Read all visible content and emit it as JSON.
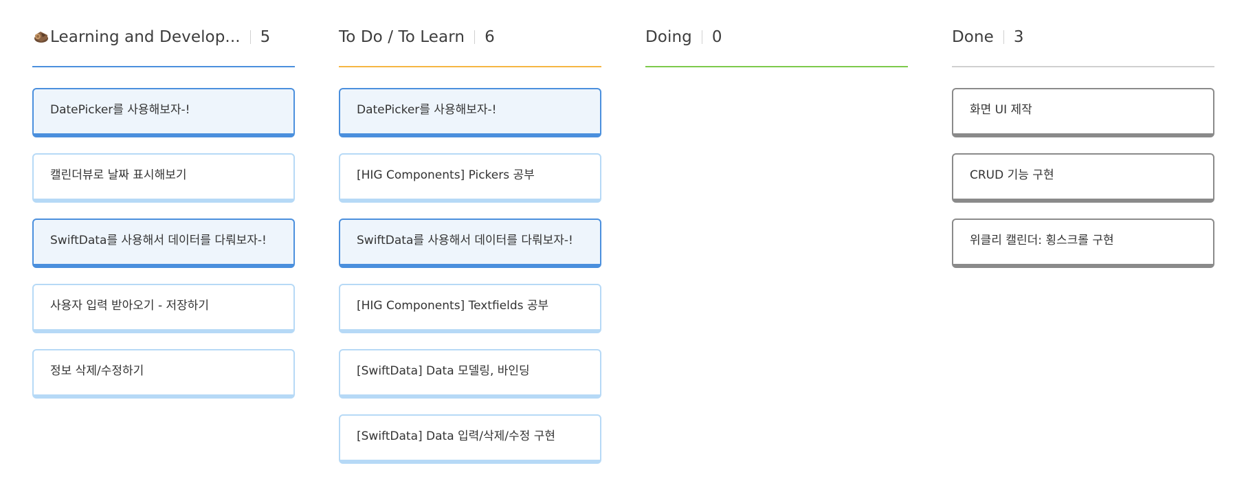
{
  "board": {
    "columns": [
      {
        "title": "Learning and Develop...",
        "count": "5",
        "icon": "wood-log-icon",
        "underline_color": "#4a8fdd",
        "cards": [
          {
            "text": "DatePicker를 사용해보자-!",
            "style": "highlight"
          },
          {
            "text": "캘린더뷰로 날짜 표시해보기",
            "style": "normal"
          },
          {
            "text": "SwiftData를 사용해서 데이터를 다뤄보자-!",
            "style": "highlight"
          },
          {
            "text": "사용자 입력 받아오기 - 저장하기",
            "style": "normal"
          },
          {
            "text": "정보 삭제/수정하기",
            "style": "normal"
          }
        ]
      },
      {
        "title": "To Do / To Learn",
        "count": "6",
        "underline_color": "#f5b642",
        "cards": [
          {
            "text": "DatePicker를 사용해보자-!",
            "style": "highlight"
          },
          {
            "text": "[HIG Components] Pickers 공부",
            "style": "normal"
          },
          {
            "text": "SwiftData를 사용해서 데이터를 다뤄보자-!",
            "style": "highlight"
          },
          {
            "text": "[HIG Components] Textfields 공부",
            "style": "normal"
          },
          {
            "text": "[SwiftData] Data 모델링, 바인딩",
            "style": "normal"
          },
          {
            "text": "[SwiftData] Data 입력/삭제/수정 구현",
            "style": "normal"
          }
        ]
      },
      {
        "title": "Doing",
        "count": "0",
        "underline_color": "#7cc94a",
        "cards": []
      },
      {
        "title": "Done",
        "count": "3",
        "underline_color": "#cfcfcf",
        "cards": [
          {
            "text": "화면 UI 제작",
            "style": "done"
          },
          {
            "text": "CRUD 기능 구현",
            "style": "done"
          },
          {
            "text": "위클리 캘린더: 횡스크롤  구현",
            "style": "done"
          }
        ]
      }
    ]
  }
}
